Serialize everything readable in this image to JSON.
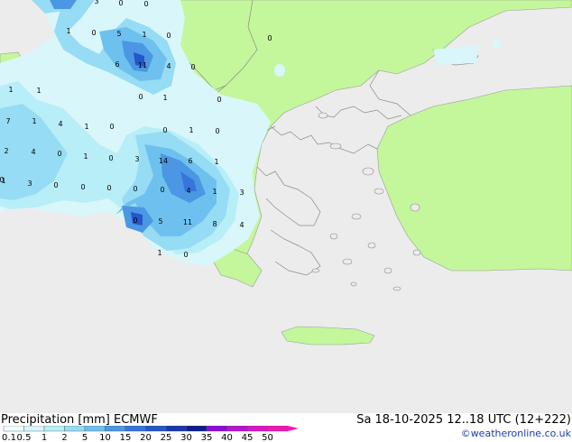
{
  "title": "Precipitation [mm]  ECMWF",
  "datetime": "Sa 18-10-2025 12..18 UTC (12+222)",
  "credit": "©weatheronline.co.uk",
  "legend": {
    "labels": [
      "0.1",
      "0.5",
      "1",
      "2",
      "5",
      "10",
      "15",
      "20",
      "25",
      "30",
      "35",
      "40",
      "45",
      "50"
    ],
    "colors": [
      "#f0ffff",
      "#d9f6fb",
      "#b8eef8",
      "#96dcf4",
      "#6ec1ee",
      "#4b97e3",
      "#3476dc",
      "#2457c9",
      "#1538b0",
      "#0c1d8f",
      "#8d0ad7",
      "#b812d2",
      "#d915c9",
      "#ee19b2"
    ]
  },
  "map_values": [
    {
      "v": "3"
    },
    {
      "v": "0"
    },
    {
      "v": "0"
    },
    {
      "v": "1"
    },
    {
      "v": "0"
    },
    {
      "v": "5"
    },
    {
      "v": "1"
    },
    {
      "v": "0"
    },
    {
      "v": "6"
    },
    {
      "v": "11"
    },
    {
      "v": "4"
    },
    {
      "v": "0"
    },
    {
      "v": "1"
    },
    {
      "v": "1"
    },
    {
      "v": "0"
    },
    {
      "v": "1"
    },
    {
      "v": "0"
    },
    {
      "v": "0"
    },
    {
      "v": "1"
    },
    {
      "v": "4"
    },
    {
      "v": "1"
    },
    {
      "v": "0"
    },
    {
      "v": "0"
    },
    {
      "v": "1"
    },
    {
      "v": "0"
    },
    {
      "v": "2"
    },
    {
      "v": "4"
    },
    {
      "v": "0"
    },
    {
      "v": "1"
    },
    {
      "v": "0"
    },
    {
      "v": "3"
    },
    {
      "v": "14"
    },
    {
      "v": "6"
    },
    {
      "v": "1"
    },
    {
      "v": "1"
    },
    {
      "v": "3"
    },
    {
      "v": "0"
    },
    {
      "v": "0"
    },
    {
      "v": "0"
    },
    {
      "v": "0"
    },
    {
      "v": "0"
    },
    {
      "v": "4"
    },
    {
      "v": "1"
    },
    {
      "v": "3"
    },
    {
      "v": "0"
    },
    {
      "v": "5"
    },
    {
      "v": "11"
    },
    {
      "v": "8"
    },
    {
      "v": "4"
    },
    {
      "v": "1"
    },
    {
      "v": "0"
    },
    {
      "v": "7"
    },
    {
      "v": "0"
    }
  ]
}
